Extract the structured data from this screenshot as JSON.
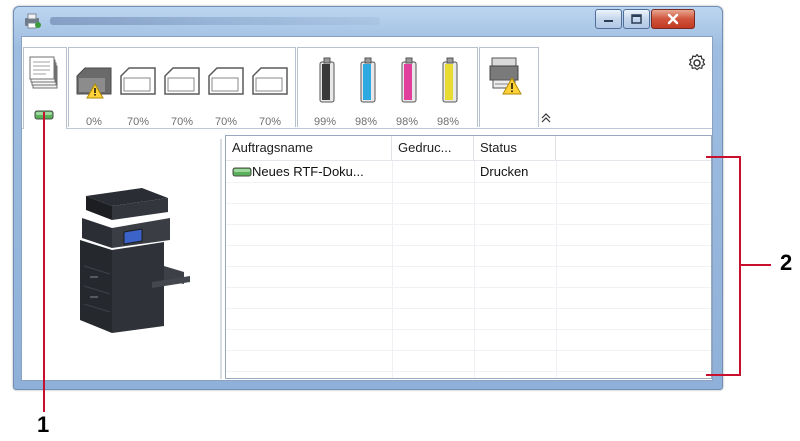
{
  "window": {
    "title": ""
  },
  "toolbar": {
    "tray_levels": [
      "0%",
      "70%",
      "70%",
      "70%",
      "70%"
    ],
    "toner_levels": [
      "99%",
      "98%",
      "98%",
      "98%"
    ],
    "toner_colors": [
      "#3a3a3a",
      "#2ea8e0",
      "#e23f9c",
      "#e8dc32"
    ]
  },
  "table": {
    "columns": [
      "Auftragsname",
      "Gedruc...",
      "Status",
      ""
    ],
    "rows": [
      {
        "name": "Neues RTF-Doku...",
        "printed": "",
        "status": "Drucken"
      }
    ]
  },
  "callouts": {
    "left": "1",
    "right": "2"
  },
  "colors": {
    "callout_line": "#c8102e",
    "window_frame": "#9fbde1",
    "close_button": "#c13a22"
  }
}
